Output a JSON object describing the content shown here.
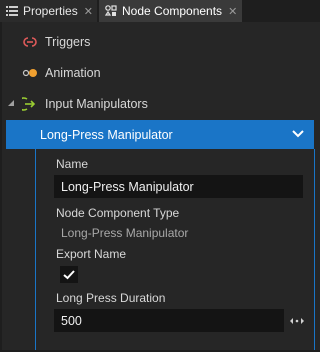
{
  "tabs": [
    {
      "label": "Properties",
      "icon": "list-icon",
      "close": "✕"
    },
    {
      "label": "Node Components",
      "icon": "components-icon",
      "close": "✕"
    }
  ],
  "components": [
    {
      "label": "Triggers",
      "icon": "trigger-icon",
      "color": "#e05a5a"
    },
    {
      "label": "Animation",
      "icon": "animation-icon",
      "color": "#f0a030"
    },
    {
      "label": "Input Manipulators",
      "icon": "input-manipulators-icon",
      "color": "#9acd32",
      "expanded": true
    }
  ],
  "selected": {
    "title": "Long-Press Manipulator",
    "accent": "#1a75c7"
  },
  "properties": {
    "name_label": "Name",
    "name_value": "Long-Press Manipulator",
    "type_label": "Node Component Type",
    "type_value": "Long-Press Manipulator",
    "export_label": "Export Name",
    "export_checked": true,
    "duration_label": "Long Press Duration",
    "duration_value": "500"
  }
}
